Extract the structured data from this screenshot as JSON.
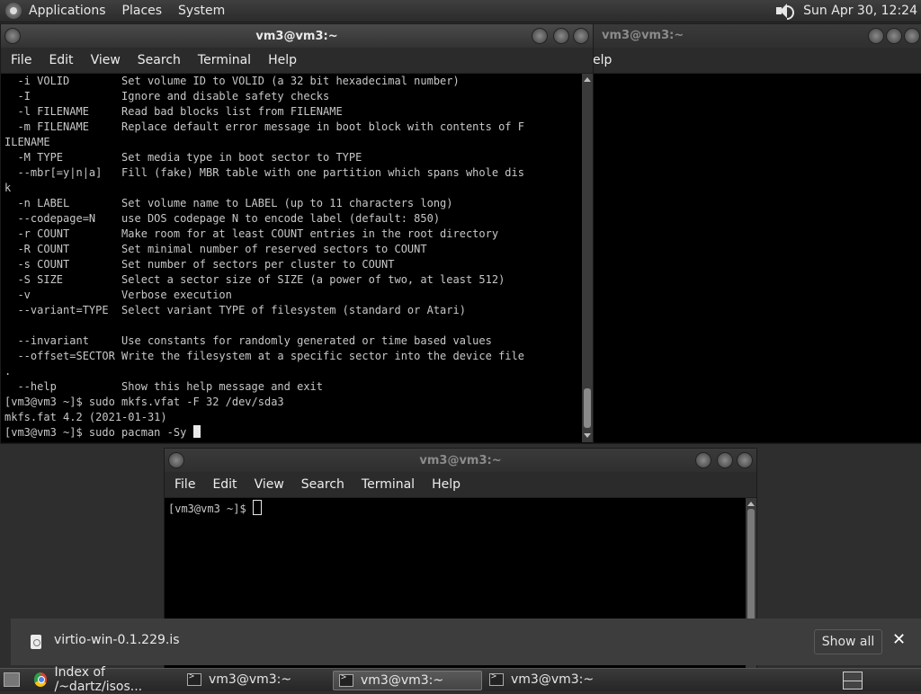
{
  "top_panel": {
    "menus": [
      "Applications",
      "Places",
      "System"
    ],
    "clock": "Sun Apr 30, 12:24"
  },
  "windows": {
    "main": {
      "title": "vm3@vm3:~",
      "menu": [
        "File",
        "Edit",
        "View",
        "Search",
        "Terminal",
        "Help"
      ],
      "lines": [
        "  -i VOLID        Set volume ID to VOLID (a 32 bit hexadecimal number)",
        "  -I              Ignore and disable safety checks",
        "  -l FILENAME     Read bad blocks list from FILENAME",
        "  -m FILENAME     Replace default error message in boot block with contents of F",
        "ILENAME",
        "  -M TYPE         Set media type in boot sector to TYPE",
        "  --mbr[=y|n|a]   Fill (fake) MBR table with one partition which spans whole dis",
        "k",
        "  -n LABEL        Set volume name to LABEL (up to 11 characters long)",
        "  --codepage=N    use DOS codepage N to encode label (default: 850)",
        "  -r COUNT        Make room for at least COUNT entries in the root directory",
        "  -R COUNT        Set minimal number of reserved sectors to COUNT",
        "  -s COUNT        Set number of sectors per cluster to COUNT",
        "  -S SIZE         Select a sector size of SIZE (a power of two, at least 512)",
        "  -v              Verbose execution",
        "  --variant=TYPE  Select variant TYPE of filesystem (standard or Atari)",
        "",
        "  --invariant     Use constants for randomly generated or time based values",
        "  --offset=SECTOR Write the filesystem at a specific sector into the device file",
        ".",
        "  --help          Show this help message and exit",
        "[vm3@vm3 ~]$ sudo mkfs.vfat -F 32 /dev/sda3",
        "mkfs.fat 4.2 (2021-01-31)"
      ],
      "prompt": "[vm3@vm3 ~]$ sudo pacman -Sy "
    },
    "back": {
      "title": "vm3@vm3:~",
      "menu_fragment": "elp"
    },
    "bottom": {
      "title": "vm3@vm3:~",
      "menu": [
        "File",
        "Edit",
        "View",
        "Search",
        "Terminal",
        "Help"
      ],
      "prompt": "[vm3@vm3 ~]$ "
    }
  },
  "download_bar": {
    "file_name": "virtio-win-0.1.229.is",
    "show_all": "Show all",
    "close": "✕"
  },
  "taskbar": {
    "tasks": [
      {
        "label": "Index of /~dartz/isos...",
        "icon": "chrome-icon",
        "active": false
      },
      {
        "label": "vm3@vm3:~",
        "icon": "terminal-icon",
        "active": false
      },
      {
        "label": "vm3@vm3:~",
        "icon": "terminal-icon",
        "active": true
      },
      {
        "label": "vm3@vm3:~",
        "icon": "terminal-icon",
        "active": false
      }
    ]
  }
}
